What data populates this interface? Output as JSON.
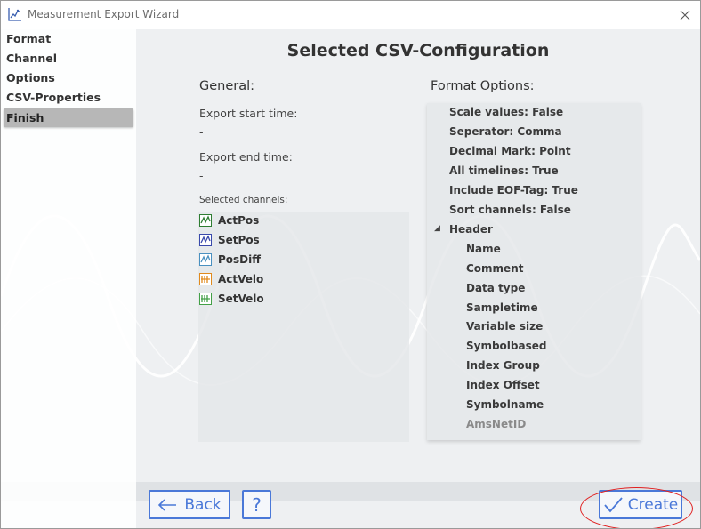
{
  "window": {
    "title": "Measurement Export Wizard"
  },
  "sidebar": {
    "items": [
      {
        "label": "Format"
      },
      {
        "label": "Channel"
      },
      {
        "label": "Options"
      },
      {
        "label": "CSV-Properties"
      },
      {
        "label": "Finish"
      }
    ],
    "active_item": "Finish"
  },
  "main": {
    "heading": "Selected CSV-Configuration",
    "general": {
      "title": "General:",
      "export_start_label": "Export start time:",
      "export_start_value": "-",
      "export_end_label": "Export end time:",
      "export_end_value": "-",
      "selected_channels_label": "Selected channels:",
      "channels": [
        {
          "name": "ActPos",
          "color": "#2e7d32"
        },
        {
          "name": "SetPos",
          "color": "#3949ab"
        },
        {
          "name": "PosDiff",
          "color": "#4a90c0"
        },
        {
          "name": "ActVelo",
          "color": "#e08a1e"
        },
        {
          "name": "SetVelo",
          "color": "#43a047"
        }
      ]
    },
    "format_options": {
      "title": "Format Options:",
      "items": [
        "Scale values: False",
        "Seperator: Comma",
        "Decimal Mark: Point",
        "All timelines: True",
        "Include EOF-Tag: True",
        "Sort channels: False"
      ],
      "header_group": {
        "label": "Header",
        "expander": "◢",
        "children": [
          "Name",
          "Comment",
          "Data type",
          "Sampletime",
          "Variable size",
          "Symbolbased",
          "Index Group",
          "Index Offset",
          "Symbolname",
          "AmsNetID"
        ]
      }
    }
  },
  "footer": {
    "back_label": "Back",
    "help_label": "?",
    "create_label": "Create"
  },
  "colors": {
    "accent": "#4a78d8",
    "highlight": "#e02020"
  }
}
